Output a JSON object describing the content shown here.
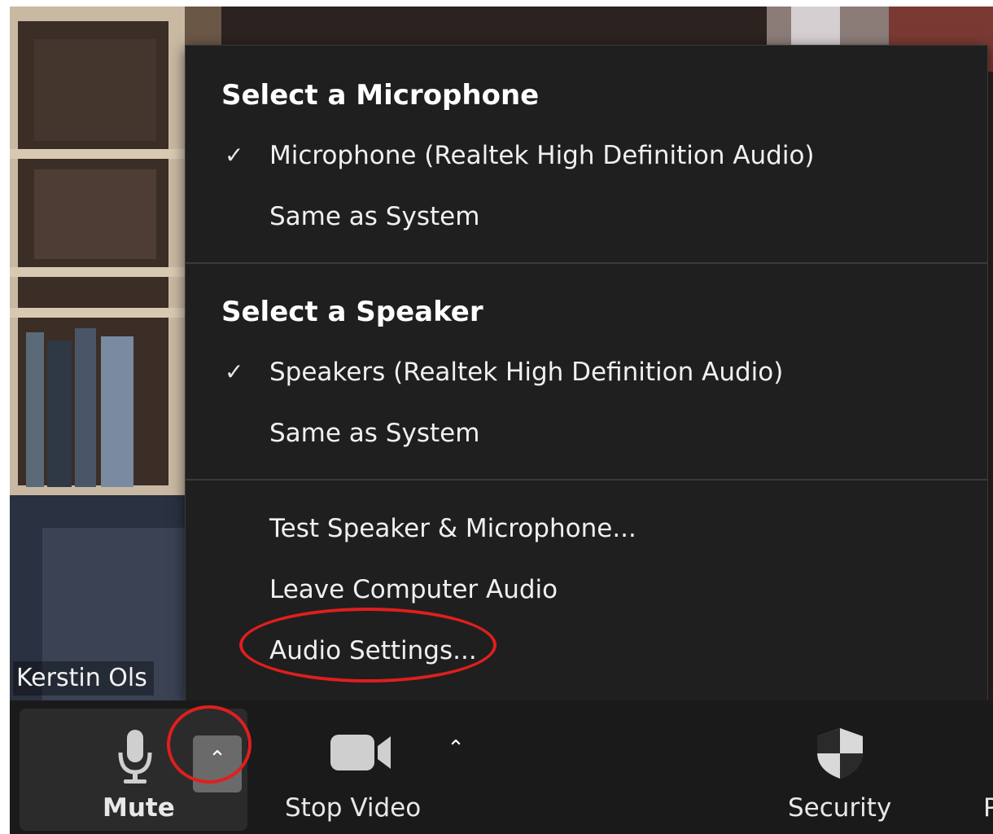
{
  "participant": {
    "name": "Kerstin Ols"
  },
  "audio_menu": {
    "microphone_heading": "Select a Microphone",
    "microphone_items": [
      {
        "label": "Microphone (Realtek High Definition Audio)",
        "checked": true
      },
      {
        "label": "Same as System",
        "checked": false
      }
    ],
    "speaker_heading": "Select a Speaker",
    "speaker_items": [
      {
        "label": "Speakers (Realtek High Definition Audio)",
        "checked": true
      },
      {
        "label": "Same as System",
        "checked": false
      }
    ],
    "actions": [
      {
        "label": "Test Speaker & Microphone..."
      },
      {
        "label": "Leave Computer Audio"
      },
      {
        "label": "Audio Settings..."
      }
    ],
    "check_glyph": "✓"
  },
  "toolbar": {
    "mute_label": "Mute",
    "stop_video_label": "Stop Video",
    "security_label": "Security",
    "partial_label": "P",
    "arrow_glyph": "⌃"
  },
  "colors": {
    "menu_background": "#1f1f1f",
    "toolbar_background": "#1a1a1a",
    "highlight_circle": "#e01e1e",
    "mute_arrow_button": "#6a6a6a"
  }
}
